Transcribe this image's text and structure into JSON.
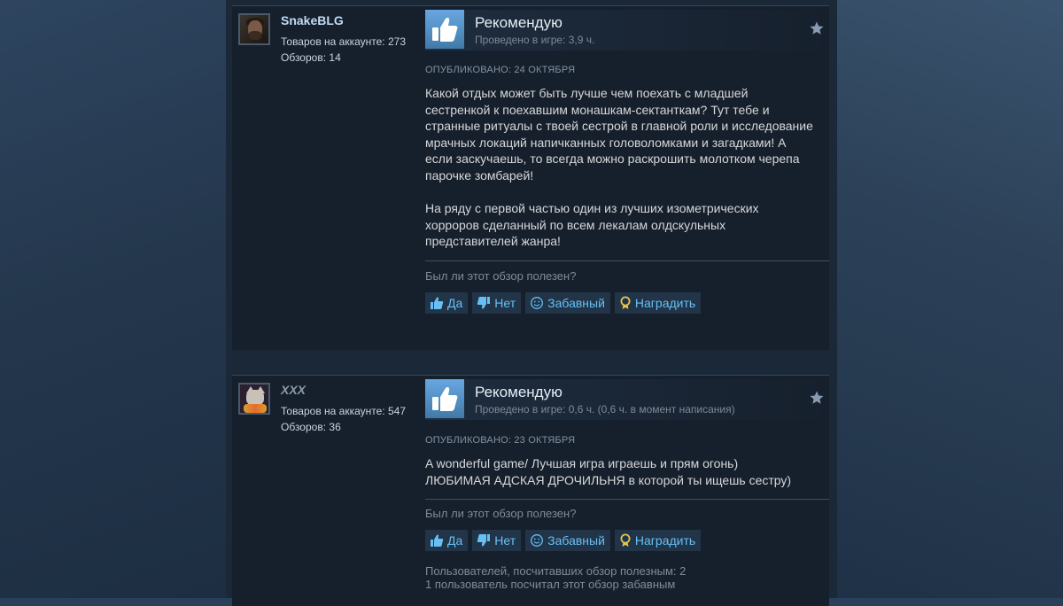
{
  "colors": {
    "page_bg": "#2a3f5a",
    "review_bg": "#16202d",
    "link_blue": "#66c0f4",
    "author_name": "#c1dbf4",
    "thumb_tile": "#5a9bd4"
  },
  "reviews": [
    {
      "author": {
        "name": "SnakeBLG",
        "products_label": "Товаров на аккаунте:",
        "products_count": "273",
        "reviews_label": "Обзоров:",
        "reviews_count": "14",
        "avatar_icon": "avatar-bearded-man"
      },
      "verdict": "Рекомендую",
      "hours": "Проведено в игре: 3,9 ч.",
      "posted": "ОПУБЛИКОВАНО: 24 ОКТЯБРЯ",
      "body": "Какой отдых может быть лучше чем поехать с младшей\nсестренкой к поехавшим монашкам-сектанткам? Тут тебе и\nстранные ритуалы с твоей сестрой в главной роли и исследование\nмрачных локаций напичканных головоломками и загадками! А\nесли заскучаешь, то всегда можно раскрошить молотком черепа\nпарочке зомбарей!\n\nНа ряду с первой частью один из лучших изометрических\nхорроров сделанный по всем лекалам олдскульных\nпредставителей жанра!",
      "helpful_question": "Был ли этот обзор полезен?",
      "buttons": {
        "yes": "Да",
        "no": "Нет",
        "funny": "Забавный",
        "award": "Наградить"
      },
      "vote_stats": []
    },
    {
      "author": {
        "name": "XXX",
        "products_label": "Товаров на аккаунте:",
        "products_count": "547",
        "reviews_label": "Обзоров:",
        "reviews_count": "36",
        "avatar_icon": "avatar-cat-with-flowers"
      },
      "verdict": "Рекомендую",
      "hours": "Проведено в игре: 0,6 ч. (0,6 ч. в момент написания)",
      "posted": "ОПУБЛИКОВАНО: 23 ОКТЯБРЯ",
      "body": "A wonderful game/ Лучшая игра играешь и прям огонь)\nЛЮБИМАЯ АДСКАЯ ДРОЧИЛЬНЯ в которой ты ищешь сестру)",
      "helpful_question": "Был ли этот обзор полезен?",
      "buttons": {
        "yes": "Да",
        "no": "Нет",
        "funny": "Забавный",
        "award": "Наградить"
      },
      "vote_stats": [
        "Пользователей, посчитавших обзор полезным: 2",
        "1 пользователь посчитал этот обзор забавным"
      ]
    }
  ]
}
